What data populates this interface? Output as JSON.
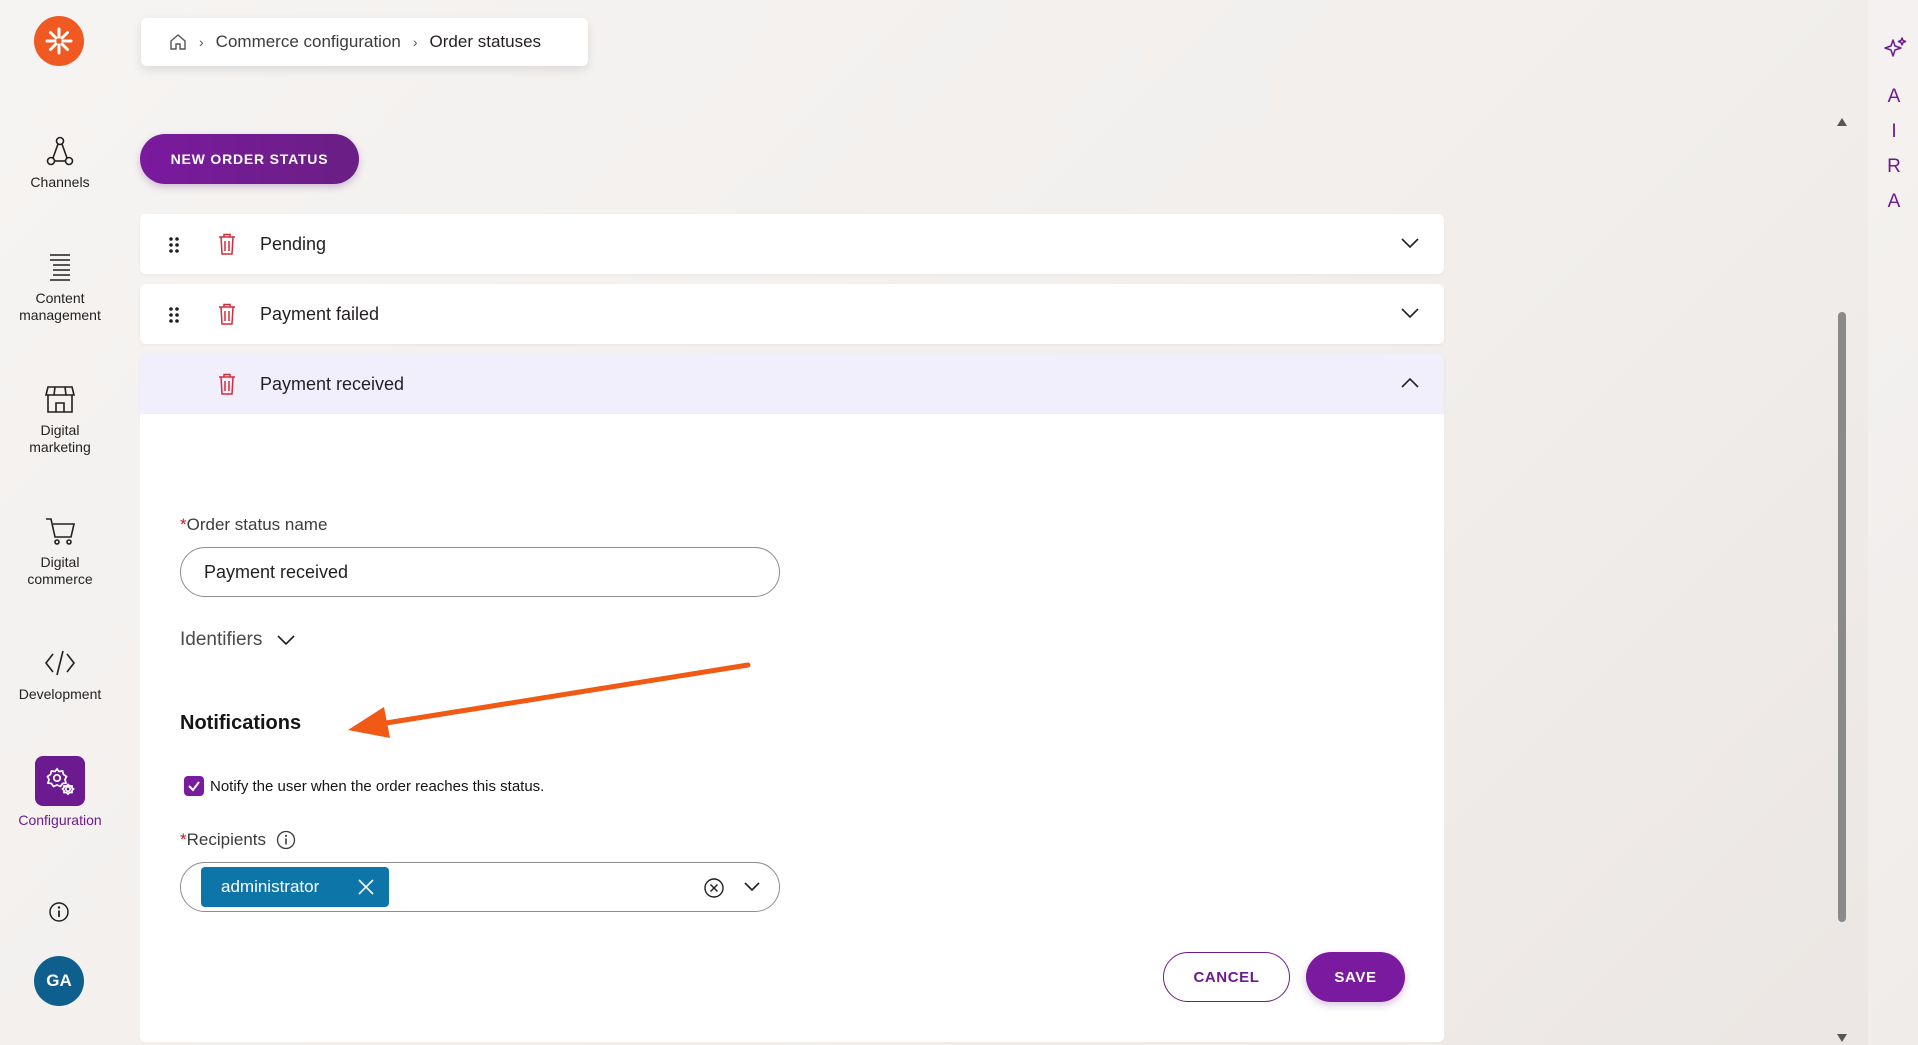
{
  "breadcrumb": {
    "link": "Commerce configuration",
    "current": "Order statuses"
  },
  "nav": {
    "items": [
      {
        "label_line1": "Channels",
        "label_line2": ""
      },
      {
        "label_line1": "Content",
        "label_line2": "management"
      },
      {
        "label_line1": "Digital",
        "label_line2": "marketing"
      },
      {
        "label_line1": "Digital",
        "label_line2": "commerce"
      },
      {
        "label_line1": "Development",
        "label_line2": ""
      },
      {
        "label_line1": "Configuration",
        "label_line2": ""
      }
    ],
    "avatar_initials": "GA"
  },
  "toolbar": {
    "new_label": "NEW ORDER STATUS"
  },
  "statuses": [
    {
      "label": "Pending"
    },
    {
      "label": "Payment failed"
    },
    {
      "label": "Payment received"
    }
  ],
  "form": {
    "required_mark": "*",
    "name_label": "Order status name",
    "name_value": "Payment received",
    "identifiers_label": "Identifiers",
    "notifications_title": "Notifications",
    "notify_label": "Notify the user when the order reaches this status.",
    "recipients_label": "Recipients",
    "recipient_tag": "administrator",
    "cancel_label": "CANCEL",
    "save_label": "SAVE"
  },
  "right_rail": {
    "letters": [
      "A",
      "I",
      "R",
      "A"
    ]
  },
  "colors": {
    "brand_purple": "#7a1a9e",
    "logo_orange": "#f05a22",
    "tag_blue": "#0e75a8",
    "annotation_orange": "#f05a14"
  }
}
